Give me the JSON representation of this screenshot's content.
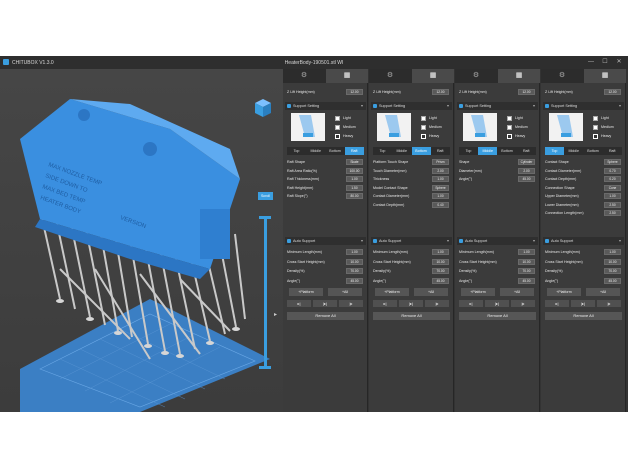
{
  "app": {
    "title": "CHITUBOX V1.3.0",
    "file_title": "HeaterBody-190501.stl WI",
    "window_buttons": [
      "—",
      "☐",
      "✕"
    ]
  },
  "viewport": {
    "cube_icon": "view-cube-icon",
    "scan_button": "Scroll",
    "model_text_top": "MAX NOZZLE TEMP",
    "model_text_lines": [
      "SIDE DOWN TO",
      "MAX BED TEMP",
      "HEATER BODY"
    ],
    "model_text_small": "VERSION"
  },
  "panels": [
    {
      "lift_label": "Z Lift Height(mm)",
      "lift_value": "12.00",
      "support_title": "Support Setting",
      "density": [
        "Light",
        "Medium",
        "Heavy"
      ],
      "density_selected": 2,
      "subtabs": [
        "Top",
        "Middle",
        "Bottom",
        "Raft"
      ],
      "subtab_active": 3,
      "params": [
        [
          "Raft Shape",
          "Skate"
        ],
        [
          "Raft Area Ratio(%)",
          "100.00"
        ],
        [
          "Raft Thickness(mm)",
          "1.00"
        ],
        [
          "Raft Height(mm)",
          "1.50"
        ],
        [
          "Raft Slope(°)",
          "80.00"
        ]
      ],
      "auto_title": "Auto Support",
      "auto_params": [
        [
          "Minimum Length(mm)",
          "1.00"
        ],
        [
          "Cross Start Height(mm)",
          "10.00"
        ],
        [
          "Density(%)",
          "70.00"
        ],
        [
          "Angle(°)",
          "45.00"
        ]
      ],
      "platform": "+Platform",
      "all": "+All",
      "remove_all": "Remove All"
    },
    {
      "lift_label": "Z Lift Height(mm)",
      "lift_value": "12.00",
      "support_title": "Support Setting",
      "density": [
        "Light",
        "Medium",
        "Heavy"
      ],
      "density_selected": 2,
      "subtabs": [
        "Top",
        "Middle",
        "Bottom",
        "Raft"
      ],
      "subtab_active": 2,
      "params": [
        [
          "Platform Touch Shape",
          "Prism"
        ],
        [
          "Touch Diameter(mm)",
          "2.00"
        ],
        [
          "Thickness",
          "1.00"
        ],
        [
          "Model Contact Shape",
          "Sphere"
        ],
        [
          "Contact Diameter(mm)",
          "1.00"
        ],
        [
          "Contact Depth(mm)",
          "0.40"
        ]
      ],
      "auto_title": "Auto Support",
      "auto_params": [
        [
          "Minimum Length(mm)",
          "1.00"
        ],
        [
          "Cross Start Height(mm)",
          "10.00"
        ],
        [
          "Density(%)",
          "70.00"
        ],
        [
          "Angle(°)",
          "45.00"
        ]
      ],
      "platform": "+Platform",
      "all": "+All",
      "remove_all": "Remove All"
    },
    {
      "lift_label": "Z Lift Height(mm)",
      "lift_value": "12.00",
      "support_title": "Support Setting",
      "density": [
        "Light",
        "Medium",
        "Heavy"
      ],
      "density_selected": 2,
      "subtabs": [
        "Top",
        "Middle",
        "Bottom",
        "Raft"
      ],
      "subtab_active": 1,
      "params": [
        [
          "Shape",
          "Cylinder"
        ],
        [
          "Diameter(mm)",
          "2.00"
        ],
        [
          "Angle(°)",
          "45.00"
        ]
      ],
      "auto_title": "Auto Support",
      "auto_params": [
        [
          "Minimum Length(mm)",
          "1.00"
        ],
        [
          "Cross Start Height(mm)",
          "10.00"
        ],
        [
          "Density(%)",
          "70.00"
        ],
        [
          "Angle(°)",
          "45.00"
        ]
      ],
      "platform": "+Platform",
      "all": "+All",
      "remove_all": "Remove All"
    },
    {
      "lift_label": "Z Lift Height(mm)",
      "lift_value": "12.00",
      "support_title": "Support Setting",
      "density": [
        "Light",
        "Medium",
        "Heavy"
      ],
      "density_selected": 2,
      "subtabs": [
        "Top",
        "Middle",
        "Bottom",
        "Raft"
      ],
      "subtab_active": 0,
      "params": [
        [
          "Contact Shape",
          "Sphere"
        ],
        [
          "Contact Diameter(mm)",
          "0.70"
        ],
        [
          "Contact Depth(mm)",
          "0.20"
        ],
        [
          "Connection Shape",
          "Cone"
        ],
        [
          "Upper Diameter(mm)",
          "1.00"
        ],
        [
          "Lower Diameter(mm)",
          "2.50"
        ],
        [
          "Connection Length(mm)",
          "2.50"
        ]
      ],
      "auto_title": "Auto Support",
      "auto_params": [
        [
          "Minimum Length(mm)",
          "1.00"
        ],
        [
          "Cross Start Height(mm)",
          "10.00"
        ],
        [
          "Density(%)",
          "70.00"
        ],
        [
          "Angle(°)",
          "45.00"
        ]
      ],
      "platform": "+Platform",
      "all": "+All",
      "remove_all": "Remove All"
    }
  ]
}
